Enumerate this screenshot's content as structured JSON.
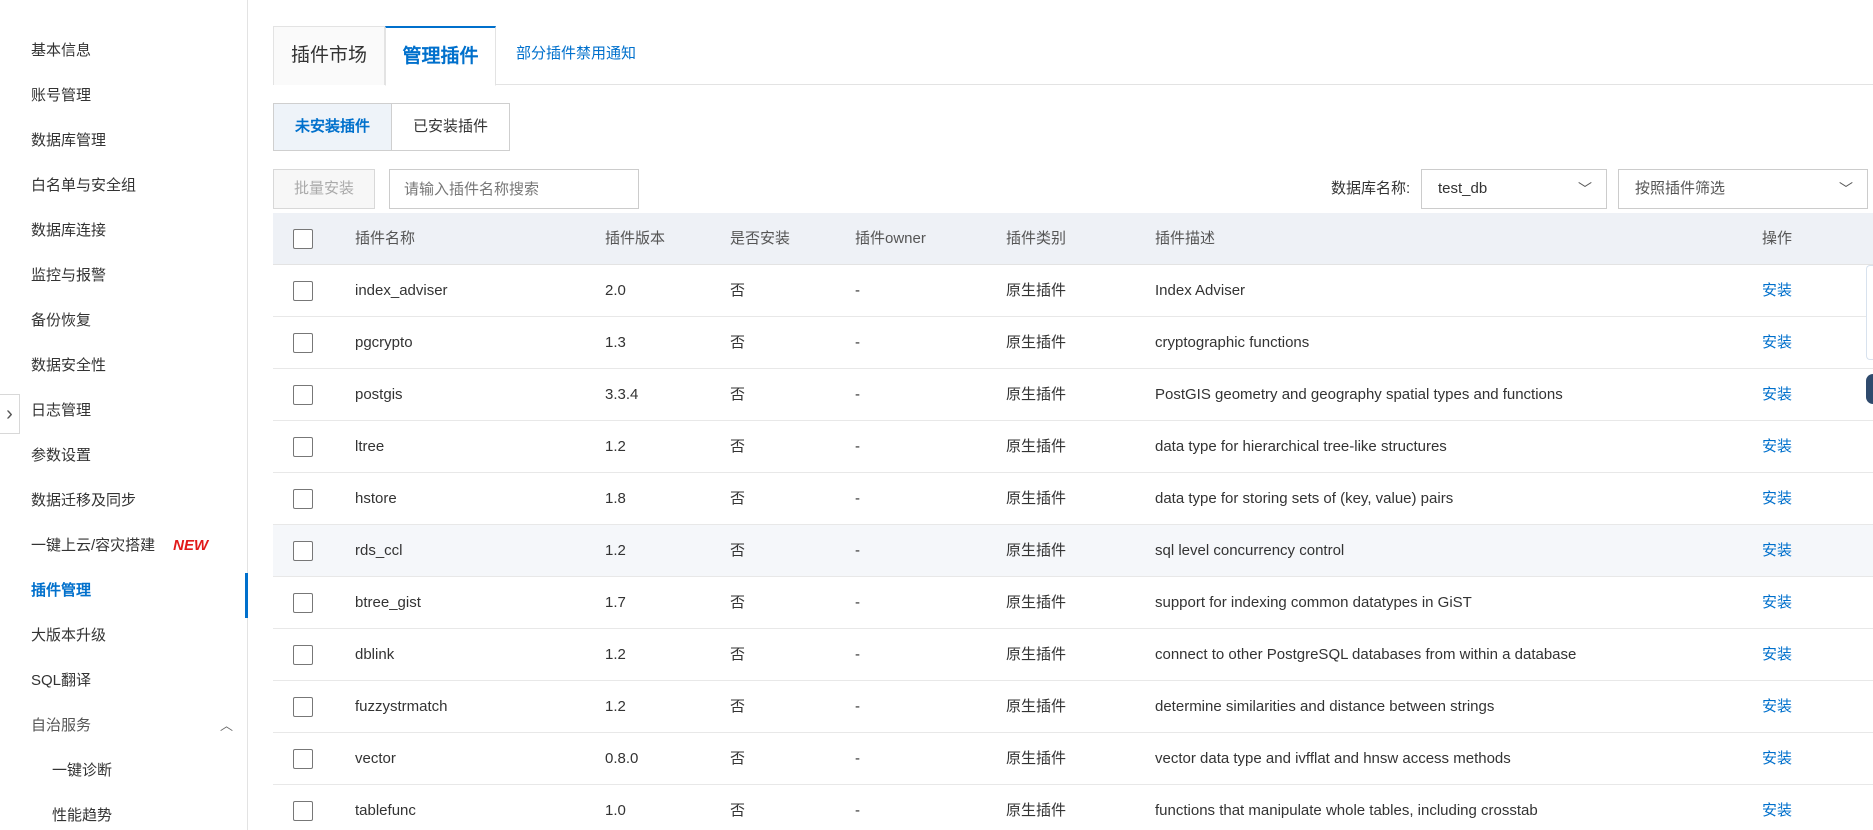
{
  "sidebar": {
    "items": [
      {
        "label": "基本信息"
      },
      {
        "label": "账号管理"
      },
      {
        "label": "数据库管理"
      },
      {
        "label": "白名单与安全组"
      },
      {
        "label": "数据库连接"
      },
      {
        "label": "监控与报警"
      },
      {
        "label": "备份恢复"
      },
      {
        "label": "数据安全性"
      },
      {
        "label": "日志管理"
      },
      {
        "label": "参数设置"
      },
      {
        "label": "数据迁移及同步"
      },
      {
        "label": "一键上云/容灾搭建",
        "badge": "NEW"
      },
      {
        "label": "插件管理",
        "active": true
      },
      {
        "label": "大版本升级"
      },
      {
        "label": "SQL翻译"
      },
      {
        "label": "自治服务"
      },
      {
        "label": "一键诊断"
      },
      {
        "label": "性能趋势"
      }
    ]
  },
  "tabs": {
    "market": "插件市场",
    "manage": "管理插件",
    "notice": "部分插件禁用通知"
  },
  "segment": {
    "not_installed": "未安装插件",
    "installed": "已安装插件"
  },
  "toolbar": {
    "batch_install": "批量安装",
    "search_placeholder": "请输入插件名称搜索",
    "db_label": "数据库名称:",
    "db_value": "test_db",
    "filter_placeholder": "按照插件筛选"
  },
  "table": {
    "headers": {
      "name": "插件名称",
      "version": "插件版本",
      "installed": "是否安装",
      "owner": "插件owner",
      "type": "插件类别",
      "desc": "插件描述",
      "op": "操作"
    },
    "rows": [
      {
        "name": "index_adviser",
        "version": "2.0",
        "installed": "否",
        "owner": "-",
        "type": "原生插件",
        "desc": "Index Adviser",
        "op": "安装"
      },
      {
        "name": "pgcrypto",
        "version": "1.3",
        "installed": "否",
        "owner": "-",
        "type": "原生插件",
        "desc": "cryptographic functions",
        "op": "安装"
      },
      {
        "name": "postgis",
        "version": "3.3.4",
        "installed": "否",
        "owner": "-",
        "type": "原生插件",
        "desc": "PostGIS geometry and geography spatial types and functions",
        "op": "安装"
      },
      {
        "name": "ltree",
        "version": "1.2",
        "installed": "否",
        "owner": "-",
        "type": "原生插件",
        "desc": "data type for hierarchical tree-like structures",
        "op": "安装"
      },
      {
        "name": "hstore",
        "version": "1.8",
        "installed": "否",
        "owner": "-",
        "type": "原生插件",
        "desc": "data type for storing sets of (key, value) pairs",
        "op": "安装"
      },
      {
        "name": "rds_ccl",
        "version": "1.2",
        "installed": "否",
        "owner": "-",
        "type": "原生插件",
        "desc": "sql level concurrency control",
        "op": "安装"
      },
      {
        "name": "btree_gist",
        "version": "1.7",
        "installed": "否",
        "owner": "-",
        "type": "原生插件",
        "desc": "support for indexing common datatypes in GiST",
        "op": "安装"
      },
      {
        "name": "dblink",
        "version": "1.2",
        "installed": "否",
        "owner": "-",
        "type": "原生插件",
        "desc": "connect to other PostgreSQL databases from within a database",
        "op": "安装"
      },
      {
        "name": "fuzzystrmatch",
        "version": "1.2",
        "installed": "否",
        "owner": "-",
        "type": "原生插件",
        "desc": "determine similarities and distance between strings",
        "op": "安装"
      },
      {
        "name": "vector",
        "version": "0.8.0",
        "installed": "否",
        "owner": "-",
        "type": "原生插件",
        "desc": "vector data type and ivfflat and hnsw access methods",
        "op": "安装"
      },
      {
        "name": "tablefunc",
        "version": "1.0",
        "installed": "否",
        "owner": "-",
        "type": "原生插件",
        "desc": "functions that manipulate whole tables, including crosstab",
        "op": "安装"
      }
    ]
  },
  "colors": {
    "accent": "#0070cc",
    "badge": "#e21a1a"
  }
}
